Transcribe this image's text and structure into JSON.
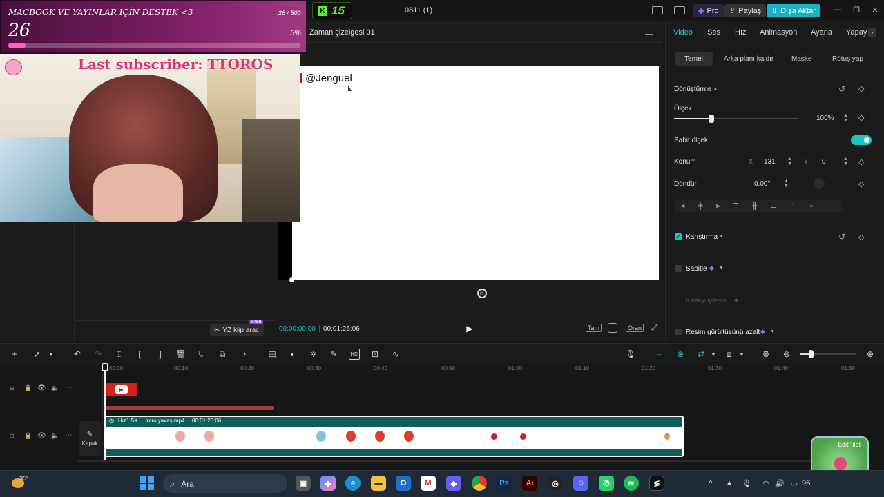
{
  "stream_overlay": {
    "goal_title": "MACBOOK VE YAYINLAR İÇİN DESTEK <3",
    "goal_count": "26 / 500",
    "goal_current": "26",
    "goal_percent": "5%",
    "goal_progress": 0.05,
    "subscriber_banner": "Last subscriber: TTOROS"
  },
  "kick_badge": {
    "count": "15"
  },
  "app": {
    "project_title": "0811 (1)",
    "timeline_title": "Zaman çizelgesi 01",
    "pro_label": "Pro",
    "share_label": "Paylaş",
    "export_label": "Dışa Aktar"
  },
  "canvas": {
    "text": "@Jenguel"
  },
  "left_panel": {
    "ai_clip_label": "YZ klip aracı",
    "free_badge": "Free"
  },
  "player": {
    "current_time": "00:00:00:00",
    "total_time": "00:01:26:06",
    "full_label": "Tam",
    "ratio_label": "Oran"
  },
  "inspector": {
    "tabs": [
      "Video",
      "Ses",
      "Hız",
      "Animasyon",
      "Ayarla",
      "Yapay"
    ],
    "subtabs": [
      "Temel",
      "Arka planı kaldır",
      "Maske",
      "Rötuş yap"
    ],
    "transform_label": "Dönüştürme",
    "scale_label": "Ölçek",
    "scale_value": "100%",
    "scale_fraction": 0.3,
    "uniform_scale_label": "Sabit ölçek",
    "position_label": "Konum",
    "pos_x_label": "X",
    "pos_x_value": "131",
    "pos_y_label": "Y",
    "pos_y_value": "0",
    "rotate_label": "Döndür",
    "rotate_value": "0.00°",
    "blend_label": "Karıştırma",
    "stabilize_label": "Sabitle",
    "enhance_label": "Kaliteyi iyileştir",
    "denoise_label": "Resim gürültüsünü azalt"
  },
  "timeline": {
    "ruler_ticks": [
      "00:00",
      "00:10",
      "00:20",
      "00:30",
      "00:40",
      "00:50",
      "01:00",
      "01:10",
      "01:20",
      "01:30",
      "01:40",
      "01:50"
    ],
    "clip_speed": "Hız1.5X",
    "clip_name": "intro yavaş.mp4",
    "clip_duration": "00:01:26:06",
    "cover_label": "Kapak",
    "watermark": "EditPilot"
  },
  "taskbar": {
    "weather_temp": "35°",
    "search_label": "Ara",
    "battery_text": "96"
  },
  "colors": {
    "accent_teal": "#19c6c6",
    "export_button": "#17b3c4",
    "pro_badge": "#7b4cf0",
    "kick_green": "#53fc18",
    "clip_track": "#0f5d5a"
  }
}
